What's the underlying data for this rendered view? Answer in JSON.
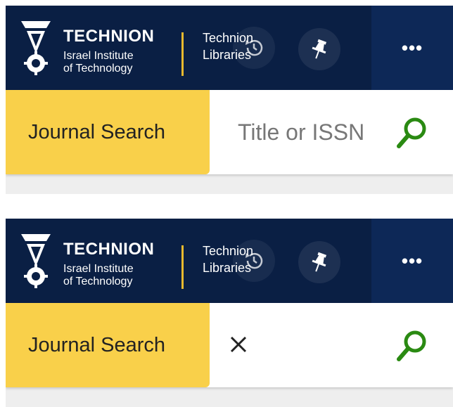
{
  "colors": {
    "header_bg": "#0a1f44",
    "more_bg": "#0d2857",
    "accent_yellow": "#f9d04a",
    "divider_gold": "#e8b92e",
    "search_green": "#2a8a12"
  },
  "panels": [
    {
      "state": "empty",
      "header": {
        "brand_name": "TECHNION",
        "brand_sub_1": "Israel Institute",
        "brand_sub_2": "of Technology",
        "lib_line_1": "Technion",
        "lib_line_2": "Libraries",
        "more_label": "•••",
        "icons": [
          "technion-logo-icon",
          "history-icon",
          "pin-icon",
          "more-icon"
        ]
      },
      "search": {
        "tab_label": "Journal Search",
        "placeholder": "Title or ISSN",
        "value": "",
        "search_icon": "search-icon"
      }
    },
    {
      "state": "clearable",
      "header": {
        "brand_name": "TECHNION",
        "brand_sub_1": "Israel Institute",
        "brand_sub_2": "of Technology",
        "lib_line_1": "Technion",
        "lib_line_2": "Libraries",
        "more_label": "•••",
        "icons": [
          "technion-logo-icon",
          "history-icon",
          "pin-icon",
          "more-icon"
        ]
      },
      "search": {
        "tab_label": "Journal Search",
        "clear_icon": "close-icon",
        "search_icon": "search-icon"
      }
    }
  ]
}
